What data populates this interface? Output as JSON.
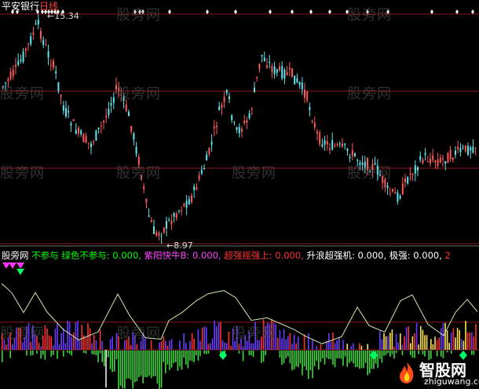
{
  "header": {
    "stock_name": "平安银行",
    "period": "日线",
    "price_high_label": "15.34",
    "price_low_label": "8.97"
  },
  "watermark": "股旁网",
  "indicator_legend": {
    "title": "股旁网",
    "items": [
      {
        "label": "不参与",
        "color": "#00ff00"
      },
      {
        "label": "绿色不参与: 0.000,",
        "color": "#00ff00"
      },
      {
        "label": "紫阳快牛B: 0.000,",
        "color": "#ff44ff"
      },
      {
        "label": "超强摇强上: 0.000,",
        "color": "#ff3030"
      },
      {
        "label": "升浪超强机: 0.000,",
        "color": "#ffffff"
      },
      {
        "label": "极强: 0.000,",
        "color": "#ffffff"
      },
      {
        "label": "2",
        "color": "#ff3030"
      }
    ]
  },
  "logo": {
    "name": "智股网",
    "url": "zhiguwang.com"
  },
  "colors": {
    "up_candle": "#ff5a5a",
    "down_candle": "#5fe6f0",
    "grid": "#8b1a1a",
    "wave_line": "#f0f0f0",
    "green_bars": "#3fd93f",
    "purple_bars": "#6a3cff",
    "red_bars": "#ff3030",
    "yellow_bars": "#ffe34a",
    "marker_green": "#00ff66",
    "marker_magenta": "#ff33ff"
  }
}
